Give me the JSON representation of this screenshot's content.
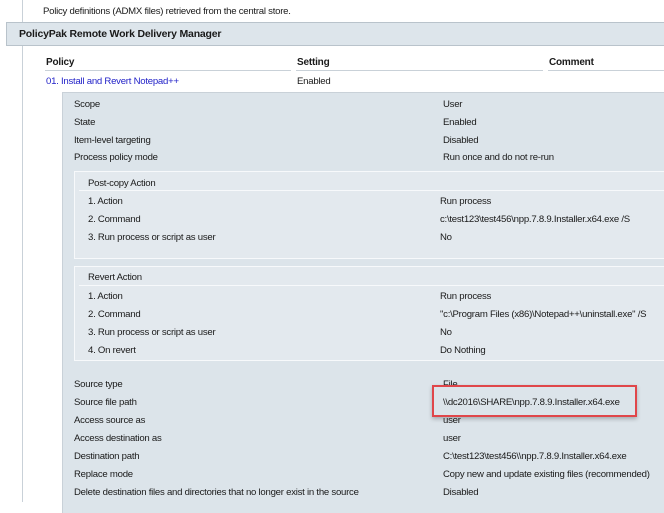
{
  "intro_text": "Policy definitions (ADMX files) retrieved from the central store.",
  "section_title": "PolicyPak Remote Work Delivery Manager",
  "columns": {
    "policy": "Policy",
    "setting": "Setting",
    "comment": "Comment"
  },
  "policy": {
    "name": "01. Install and Revert Notepad++",
    "setting": "Enabled"
  },
  "general": [
    {
      "label": "Scope",
      "value": "User"
    },
    {
      "label": "State",
      "value": "Enabled"
    },
    {
      "label": "Item-level targeting",
      "value": "Disabled"
    },
    {
      "label": "Process policy mode",
      "value": "Run once and do not re-run"
    }
  ],
  "post_copy": {
    "title": "Post-copy Action",
    "rows": [
      {
        "label": "1. Action",
        "value": "Run process"
      },
      {
        "label": "2. Command",
        "value": "c:\\test123\\test456\\npp.7.8.9.Installer.x64.exe /S"
      },
      {
        "label": "3. Run process or script as user",
        "value": "No"
      }
    ]
  },
  "revert": {
    "title": "Revert Action",
    "rows": [
      {
        "label": "1. Action",
        "value": "Run process"
      },
      {
        "label": "2. Command",
        "value": "\"c:\\Program Files (x86)\\Notepad++\\uninstall.exe\" /S"
      },
      {
        "label": "3. Run process or script as user",
        "value": "No"
      },
      {
        "label": "4. On revert",
        "value": "Do Nothing"
      }
    ]
  },
  "source": [
    {
      "label": "Source type",
      "value": "File"
    },
    {
      "label": "Source file path",
      "value": "\\\\dc2016\\SHARE\\npp.7.8.9.Installer.x64.exe"
    },
    {
      "label": "Access source as",
      "value": "user"
    },
    {
      "label": "Access destination as",
      "value": "user"
    },
    {
      "label": "Destination path",
      "value": "C:\\test123\\test456\\\\npp.7.8.9.Installer.x64.exe"
    },
    {
      "label": "Replace mode",
      "value": "Copy new and update existing files (recommended)"
    },
    {
      "label": "Delete destination files and directories that no longer exist in the source",
      "value": "Disabled"
    }
  ],
  "highlight_color": "#e0464a"
}
